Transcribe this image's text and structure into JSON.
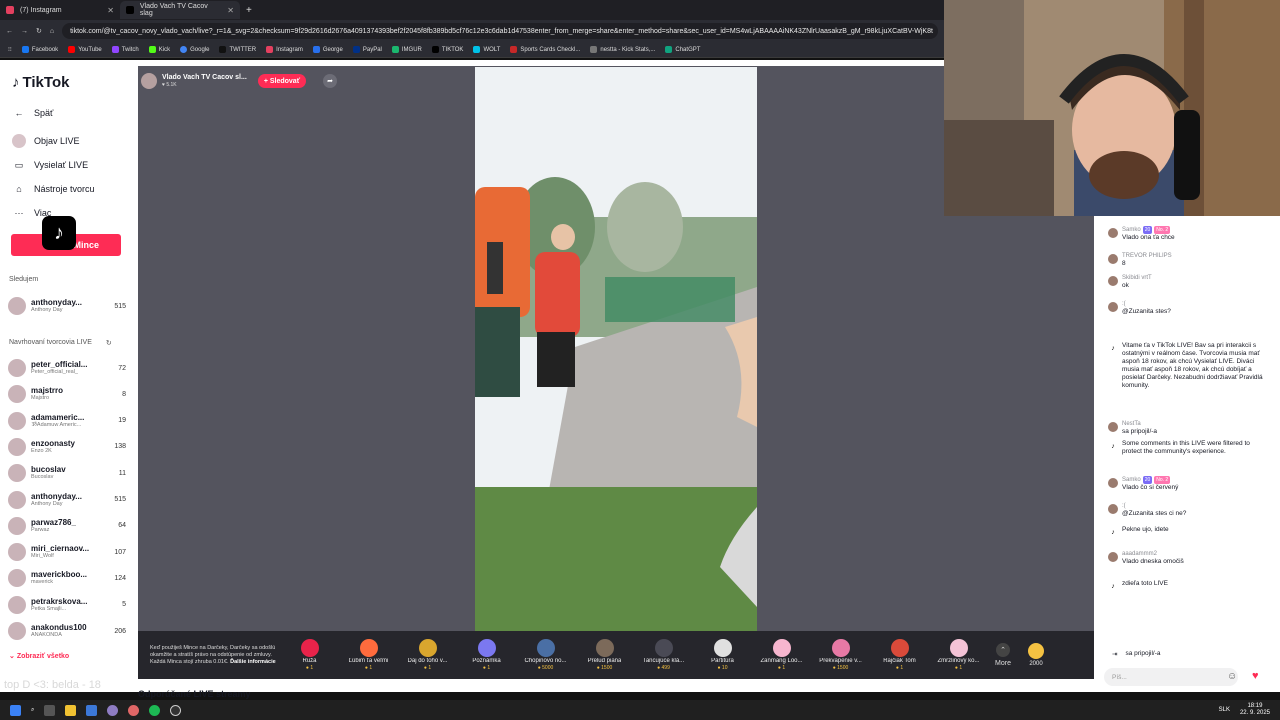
{
  "browser": {
    "tabs": [
      {
        "label": "(7) Instagram",
        "active": false
      },
      {
        "label": "Vlado Vach TV Cacov slag",
        "active": true
      }
    ],
    "url": "tiktok.com/@tv_cacov_novy_vlado_vach/live?_r=1&_svg=2&checksum=9f29d2616d2676a4091374393bef2f2045f8fb389bd5cf76c12e3c6dab1d47538enter_from_merge=share&enter_method=share&sec_user_id=MS4wLjABAAAAiNK43ZNlrUaasakzB_gM_r98kLjuXCatBV-WjK8t",
    "bookmarks": [
      "Facebook",
      "YouTube",
      "Twitch",
      "Kick",
      "Google",
      "TWITTER",
      "Instagram",
      "George",
      "PayPal",
      "IMGUR",
      "TIKTOK",
      "WOLT",
      "Sports Cards Checkl...",
      "nestta - Kick Stats,...",
      "ChatGPT"
    ]
  },
  "sidebar": {
    "logo": "TikTok",
    "back_label": "Späť",
    "nav": [
      {
        "label": "Objav LIVE",
        "icon": "live-discover-icon"
      },
      {
        "label": "Vysielať LIVE",
        "icon": "broadcast-icon"
      },
      {
        "label": "Nástroje tvorcu",
        "icon": "creator-tools-icon"
      },
      {
        "label": "Viac",
        "icon": "more-dots-icon"
      }
    ],
    "coins_button": "Mince",
    "following_title": "Sledujem",
    "following": [
      {
        "name": "anthonyday...",
        "sub": "Anthony Day",
        "count": "515"
      }
    ],
    "suggested_title": "Navrhovaní tvorcovia LIVE",
    "suggested": [
      {
        "name": "peter_official...",
        "sub": "Peter_official_real_",
        "count": "72"
      },
      {
        "name": "majstrro",
        "sub": "Majstro",
        "count": "8"
      },
      {
        "name": "adamameric...",
        "sub": "ૐAdamuw Americ...",
        "count": "19"
      },
      {
        "name": "enzoonasty",
        "sub": "Enzo 2K",
        "count": "138"
      },
      {
        "name": "bucoslav",
        "sub": "Bucoslav",
        "count": "11"
      },
      {
        "name": "anthonyday...",
        "sub": "Anthony Day",
        "count": "515"
      },
      {
        "name": "parwaz786_",
        "sub": "Parwaz",
        "count": "64"
      },
      {
        "name": "miri_ciernaov...",
        "sub": "Miri_Wolf",
        "count": "107"
      },
      {
        "name": "maverickboo...",
        "sub": "maverick",
        "count": "124"
      },
      {
        "name": "petrakrskova...",
        "sub": "Petka Smajli...",
        "count": "5"
      },
      {
        "name": "anakondus100",
        "sub": "ANAKONDA",
        "count": "206"
      }
    ],
    "show_all": "Zobraziť všetko",
    "bottom_text": "Odporúčané LIVE streamy"
  },
  "stream": {
    "host_name": "Vlado Vach TV Cacov sl...",
    "host_likes": "5.1K",
    "follow_label": "+ Sledovať"
  },
  "gifts": {
    "note": "Keď použiješ Mince na Darčeky, Darčeky sa odošlú okamžite a stratíš právo na odstúpenie od zmluvy. Každá Minca stojí zhruba 0.01€.",
    "note_link": "Ďalšie informácie",
    "items": [
      {
        "name": "Ruža",
        "price": "1",
        "color": "#e8234a"
      },
      {
        "name": "Ľúbim ťa veľmi",
        "price": "1",
        "color": "#ff6b3d"
      },
      {
        "name": "Daj do toho v...",
        "price": "1",
        "color": "#d9a62e"
      },
      {
        "name": "Poznámka",
        "price": "1",
        "color": "#7b78f0"
      },
      {
        "name": "Chopinovo no...",
        "price": "5000",
        "color": "#4a6fa5"
      },
      {
        "name": "Prelud piana",
        "price": "1500",
        "color": "#7c6a5a"
      },
      {
        "name": "Tancujúce klá...",
        "price": "499",
        "color": "#4a4a55"
      },
      {
        "name": "Partitúra",
        "price": "10",
        "color": "#e0e0e0"
      },
      {
        "name": "Zanmang Loo...",
        "price": "1",
        "color": "#f7b6cf"
      },
      {
        "name": "Prekvapenie v...",
        "price": "1500",
        "color": "#e779a5"
      },
      {
        "name": "Rajčiak Tom",
        "price": "1",
        "color": "#d94a3a"
      },
      {
        "name": "Zmrzlinový ko...",
        "price": "1",
        "color": "#f4c3d6"
      }
    ],
    "more_label": "More",
    "coins_count": "2000"
  },
  "chat": {
    "messages": [
      {
        "user": "Samko",
        "badge": "20",
        "badge2": "No. 2",
        "text": "Vlado ona ťa chce"
      },
      {
        "user": "TREVOR PHILIPS",
        "text": "8"
      },
      {
        "user": "Skibidi vrtT",
        "text": "ok"
      },
      {
        "user": ":(",
        "text": "@Zuzanita stes?"
      },
      {
        "user": "",
        "text": "Vitame ťa v TikTok LIVE! Bav sa pri interakcii s ostatnými v reálnom čase. Tvorcovia musia mať aspoň 18 rokov, ak chcú Vysielať LIVE. Diváci musia mať aspoň 18 rokov, ak chcú dobíjať a posielať Darčeky. Nezabudni dodržiavať Pravidlá komunity."
      },
      {
        "user": "NestTa",
        "text": "sa pripojil/-a"
      },
      {
        "user": "",
        "text": "Some comments in this LIVE were filtered to protect the community's experience."
      },
      {
        "user": "Samko",
        "badge": "20",
        "badge2": "No. 2",
        "text": "Vlado čo si červený"
      },
      {
        "user": ":(",
        "text": "@Zuzanita stes ci ne?"
      },
      {
        "user": "",
        "text": "Pekne ujo, idete"
      },
      {
        "user": "aaadammm2",
        "text": "Vlado dneska omočiš"
      },
      {
        "user": "",
        "text": "zdieľa toto LIVE"
      }
    ],
    "join_text": "sa pripojil/-a",
    "input_placeholder": "Píš..."
  },
  "overlay": {
    "text": "top D <3: belda - 18"
  },
  "taskbar": {
    "lang": "SLK",
    "time": "18:19",
    "date": "22. 9. 2025"
  }
}
